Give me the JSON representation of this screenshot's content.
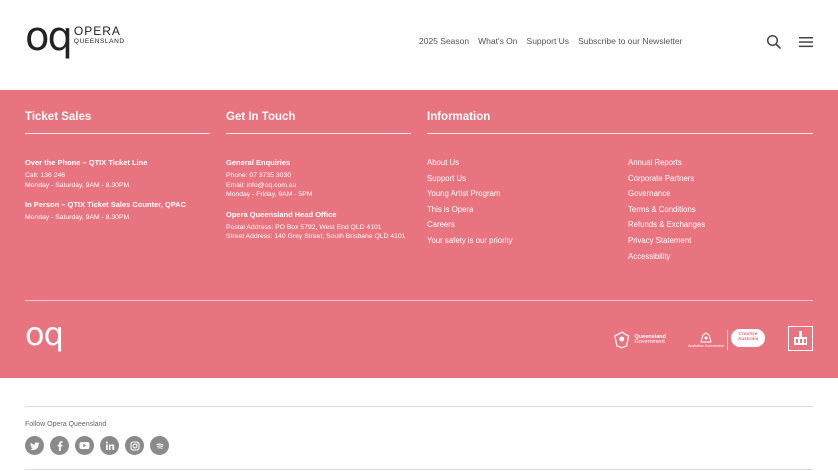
{
  "brand": {
    "mark": "oq",
    "name": "OPERA",
    "sub": "QUEENSLAND"
  },
  "nav": [
    {
      "label": "2025 Season"
    },
    {
      "label": "What's On"
    },
    {
      "label": "Support Us"
    },
    {
      "label": "Subscribe to our Newsletter"
    }
  ],
  "icons": {
    "search": "search-icon",
    "menu": "hamburger-menu-icon"
  },
  "footer": {
    "background": "#e87480",
    "ticket": {
      "title": "Ticket Sales",
      "phone_heading": "Over the Phone – QTIX Ticket Line",
      "phone_call": "Call: 136 246",
      "phone_hours": "Monday - Saturday, 9AM - 8.30PM",
      "person_heading": "In Person – QTIX Ticket Sales Counter, QPAC",
      "person_hours": "Monday - Saturday, 9AM - 8.30PM"
    },
    "contact": {
      "title": "Get In Touch",
      "general_heading": "General Enquiries",
      "phone": "Phone: 07 3735 3030",
      "email": "Email: info@oq.com.au",
      "hours": "Monday - Friday, 9AM - 5PM",
      "office_heading": "Opera Queensland Head Office",
      "postal": "Postal Address: PO Box 5792, West End QLD 4101",
      "street": "Street Address: 140 Grey Street, South Brisbane QLD 4101"
    },
    "information": {
      "title": "Information",
      "links_left": [
        "About Us",
        "Support Us",
        "Young Artist Program",
        "This is Opera",
        "Careers",
        "Your safety is our priority"
      ],
      "links_right": [
        "Annual Reports",
        "Corporate Partners",
        "Governance",
        "Terms & Conditions",
        "Refunds & Exchanges",
        "Privacy Statement",
        "Accessibility"
      ]
    },
    "partners": {
      "qld": {
        "line1": "Queensland",
        "line2": "Government"
      },
      "aus": {
        "label": "Australian Government",
        "creative": "Creative Australia"
      }
    }
  },
  "follow": {
    "label": "Follow Opera Queensland",
    "socials": [
      "twitter-icon",
      "facebook-icon",
      "youtube-icon",
      "linkedin-icon",
      "instagram-icon",
      "spotify-icon"
    ]
  }
}
